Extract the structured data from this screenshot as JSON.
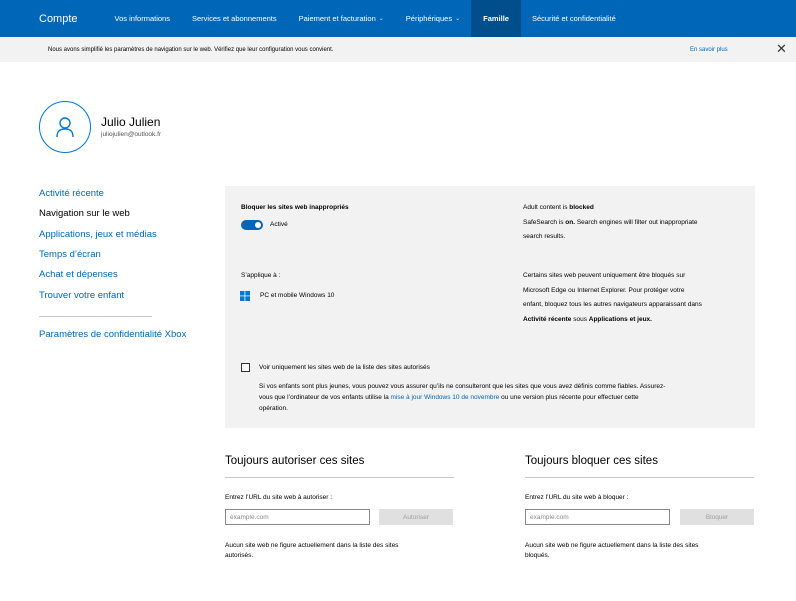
{
  "nav": {
    "brand": "Compte",
    "items": [
      {
        "label": "Vos informations",
        "dropdown": false,
        "active": false
      },
      {
        "label": "Services et abonnements",
        "dropdown": false,
        "active": false
      },
      {
        "label": "Paiement et facturation",
        "dropdown": true,
        "active": false
      },
      {
        "label": "Périphériques",
        "dropdown": true,
        "active": false
      },
      {
        "label": "Famille",
        "dropdown": false,
        "active": true
      },
      {
        "label": "Sécurité et confidentialité",
        "dropdown": false,
        "active": false
      }
    ],
    "color": "#0067b8",
    "active_color": "#004e8c"
  },
  "banner": {
    "text": "Nous avons simplifié les paramètres de navigation sur le web. Vérifiez que leur configuration vous convient.",
    "link": "En savoir plus",
    "close_icon": "close-icon"
  },
  "profile": {
    "name": "Julio Julien",
    "email": "juliojulien@outlook.fr",
    "avatar_icon": "person-icon"
  },
  "sidebar": {
    "items": [
      {
        "label": "Activité récente",
        "current": false
      },
      {
        "label": "Navigation sur le web",
        "current": true
      },
      {
        "label": "Applications, jeux et médias",
        "current": false
      },
      {
        "label": "Temps d’écran",
        "current": false
      },
      {
        "label": "Achat et dépenses",
        "current": false
      },
      {
        "label": "Trouver votre enfant",
        "current": false
      }
    ],
    "xbox": "Paramètres de confidentialité Xbox"
  },
  "panel": {
    "block_title": "Bloquer les sites web inappropriés",
    "toggle_state": "Activé",
    "toggle_on": true,
    "adult_prefix": "Adult content is ",
    "adult_value": "blocked",
    "safesearch_prefix": "SafeSearch is ",
    "safesearch_value": "on.",
    "safesearch_line1": " Search engines will filter out inappropriate",
    "safesearch_line2": "search results.",
    "applies_title": "S’applique à :",
    "applies_device": "PC et mobile Windows 10",
    "device_icon": "windows-icon",
    "info_line1": "Certains sites web peuvent uniquement être bloqués sur",
    "info_line2": "Microsoft Edge ou Internet Explorer. Pour protéger votre",
    "info_line3": "enfant, bloquez tous les autres navigateurs apparaissant dans",
    "info_bold1": "Activité récente",
    "info_mid": " sous ",
    "info_bold2": "Applications et jeux.",
    "allowed_only_label": "Voir uniquement les sites web de la liste des sites autorisés",
    "allowed_only_checked": false,
    "young_line1": "Si vos enfants sont plus jeunes, vous pouvez vous assurer qu’ils ne consulteront que les sites que vous avez définis comme fiables. Assurez-",
    "young_line2_pre": "vous que l’ordinateur de vos enfants utilise la ",
    "young_link": "mise à jour Windows 10 de novembre",
    "young_line2_post": " ou une version plus récente pour effectuer cette",
    "young_line3": "opération."
  },
  "allow": {
    "title": "Toujours autoriser ces sites",
    "label": "Entrez l’URL du site web à autoriser :",
    "placeholder": "example.com",
    "button": "Autoriser",
    "note_line1": "Aucun site web ne figure actuellement dans la liste des sites",
    "note_line2": "autorisés."
  },
  "block": {
    "title": "Toujours bloquer ces sites",
    "label": "Entrez l’URL du site web à bloquer :",
    "placeholder": "example.com",
    "button": "Bloquer",
    "note_line1": "Aucun site web ne figure actuellement dans la liste des sites",
    "note_line2": "bloqués."
  }
}
